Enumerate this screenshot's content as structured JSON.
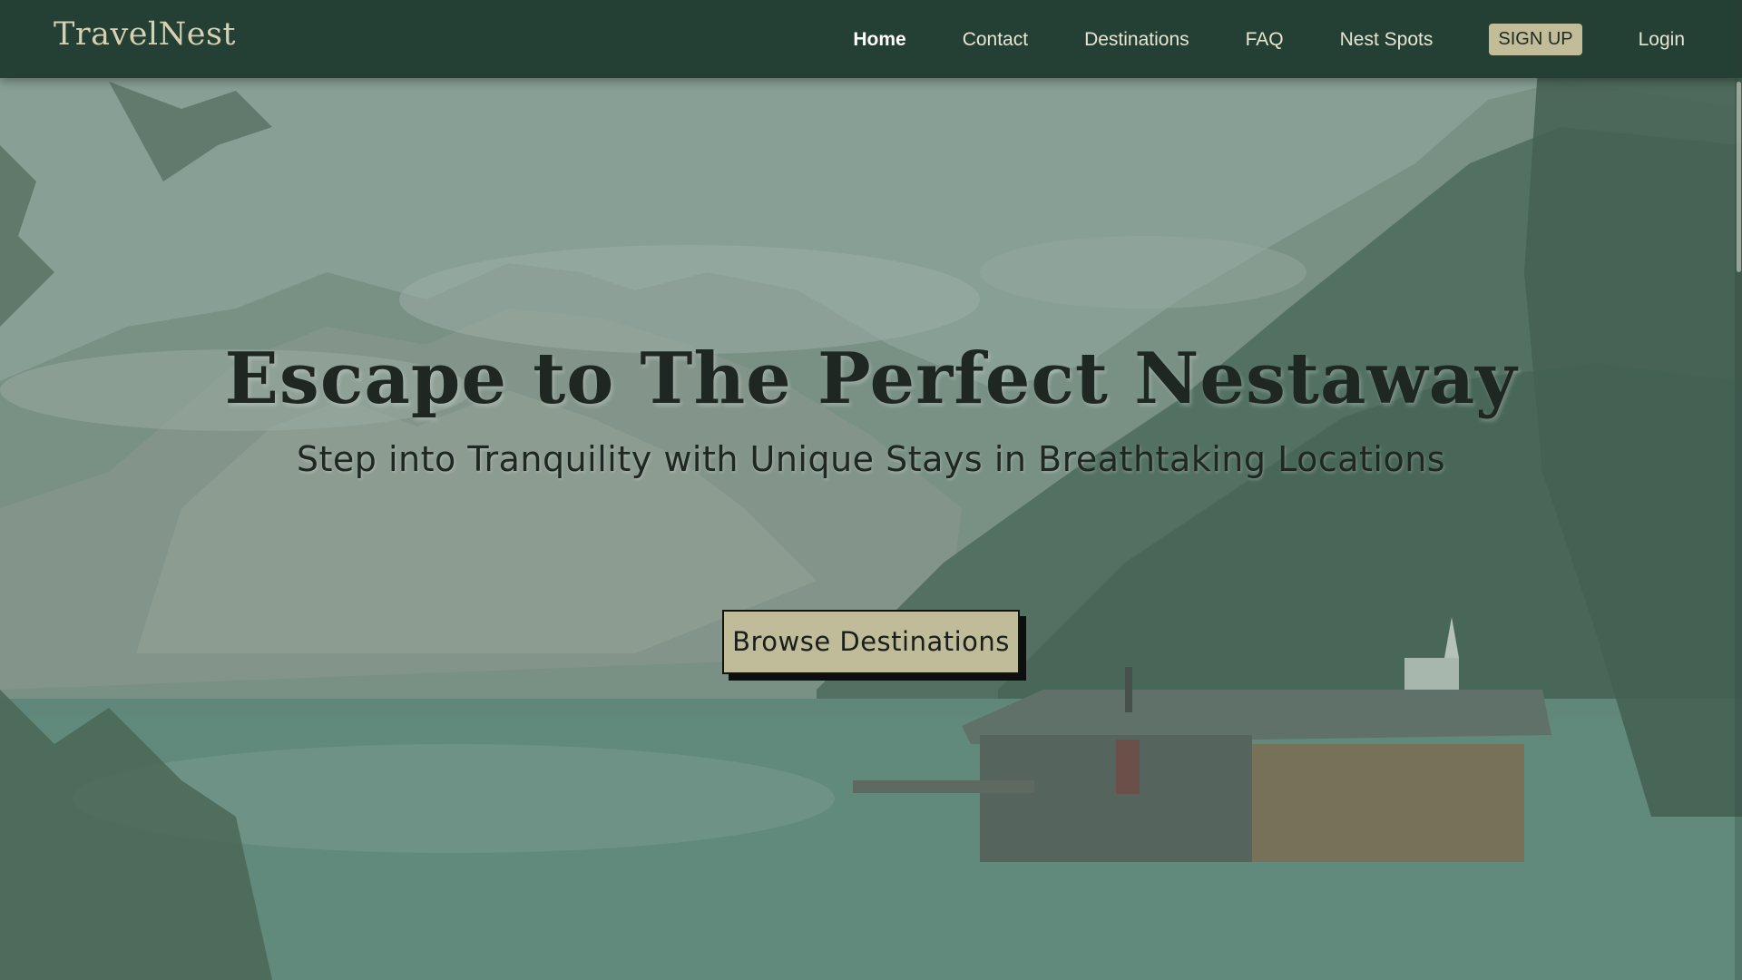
{
  "brand": {
    "name": "TravelNest"
  },
  "nav": {
    "items": [
      {
        "label": "Home",
        "active": true
      },
      {
        "label": "Contact",
        "active": false
      },
      {
        "label": "Destinations",
        "active": false
      },
      {
        "label": "FAQ",
        "active": false
      },
      {
        "label": "Nest Spots",
        "active": false
      }
    ],
    "signup_label": "SIGN UP",
    "login_label": "Login"
  },
  "hero": {
    "title": "Escape to The Perfect Nestaway",
    "subtitle": "Step into Tranquility with Unique Stays in Breathtaking Locations",
    "cta_label": "Browse Destinations"
  },
  "colors": {
    "navbar": "#244034",
    "brand_text": "#d6d0b3",
    "signup_bg": "#c2bc98",
    "cta_bg": "#c0bb99",
    "hero_text": "#1f2722"
  }
}
